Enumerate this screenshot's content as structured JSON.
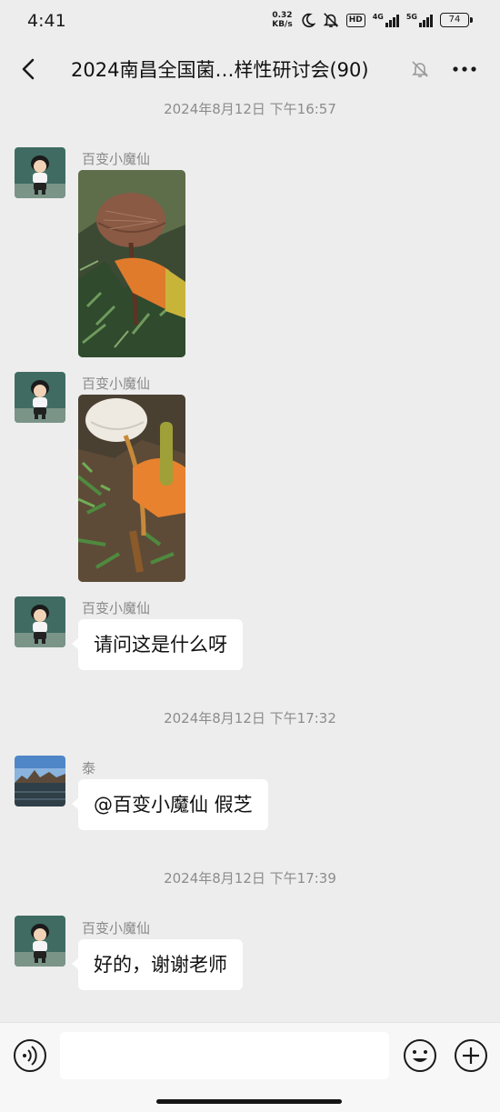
{
  "status_bar": {
    "time": "4:41",
    "net_speed_value": "0.32",
    "net_speed_unit": "KB/s",
    "hd_label": "HD",
    "signal1_label": "4G",
    "signal2_label": "5G",
    "battery": "74"
  },
  "header": {
    "title": "2024南昌全国菌…样性研讨会(90)",
    "icons": [
      "back-icon",
      "mute-bell-icon",
      "more-icon"
    ]
  },
  "messages": [
    {
      "type": "time",
      "text": "2024年8月12日 下午16:57"
    },
    {
      "type": "image",
      "sender": "百变小魔仙",
      "subject": "brown mushroom cap held by orange glove"
    },
    {
      "type": "image",
      "sender": "百变小魔仙",
      "subject": "white mushroom cap held by orange glove"
    },
    {
      "type": "text",
      "sender": "百变小魔仙",
      "text": "请问这是什么呀"
    },
    {
      "type": "time",
      "text": "2024年8月12日 下午17:32"
    },
    {
      "type": "text",
      "sender": "泰",
      "text": "@百变小魔仙  假芝"
    },
    {
      "type": "time",
      "text": "2024年8月12日 下午17:39"
    },
    {
      "type": "text",
      "sender": "百变小魔仙",
      "text": "好的，谢谢老师"
    }
  ],
  "input_bar": {
    "placeholder": "",
    "icons": [
      "voice-icon",
      "emoji-icon",
      "plus-icon"
    ]
  },
  "colors": {
    "background": "#ededed",
    "bubble": "#ffffff",
    "meta_text": "#8c8c8c"
  }
}
